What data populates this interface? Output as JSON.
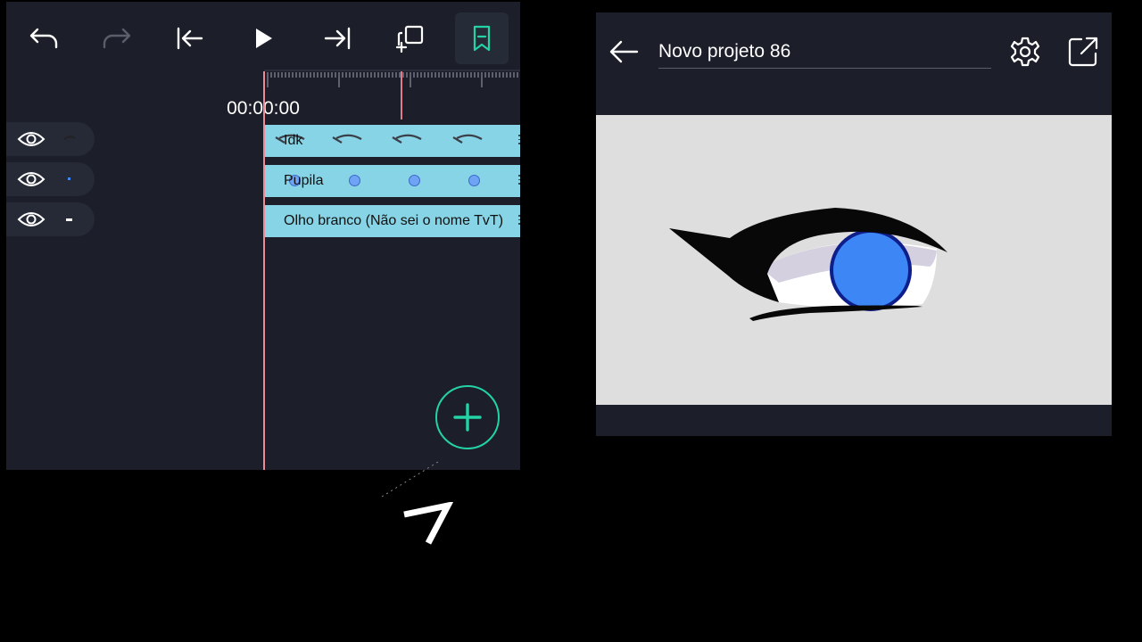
{
  "timeline": {
    "time": "00:00:00",
    "tracks": [
      {
        "name": "Idk",
        "thumb": "eye-outline-thumb",
        "keyframe_icon": "eye-shape-icon"
      },
      {
        "name": "Pupila",
        "thumb": "blue-dot-thumb",
        "keyframe_icon": "blue-dot"
      },
      {
        "name": "Olho branco (Não sei o nome TvT)",
        "thumb": "white-dash-thumb"
      }
    ]
  },
  "preview": {
    "project_title": "Novo projeto 86"
  },
  "colors": {
    "panel_bg": "#1c1f2a",
    "track_bg": "#87d4e6",
    "accent": "#23d3a6",
    "playhead": "#ee8a96",
    "pupil_blue": "#3d86f6"
  }
}
